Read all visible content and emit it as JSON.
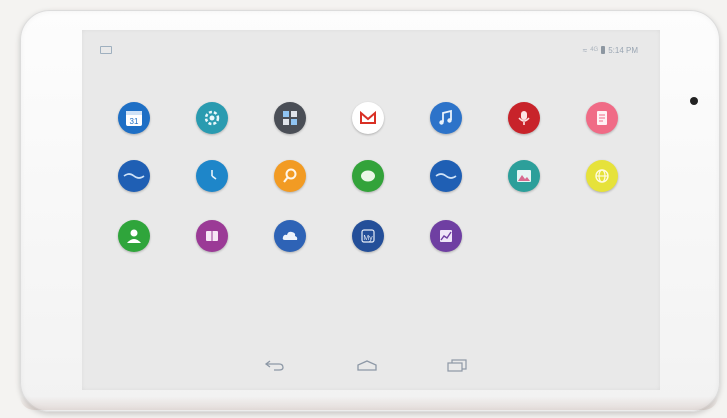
{
  "status_bar": {
    "network_label": "4G",
    "time": "5:14 PM"
  },
  "apps": [
    {
      "icon": "calendar-icon",
      "label_on_icon": "31",
      "color": "#1e6fc5"
    },
    {
      "icon": "settings-gear-icon",
      "color": "#2a9bb0"
    },
    {
      "icon": "apps-grid-icon",
      "color": "#4a4e56"
    },
    {
      "icon": "gmail-icon",
      "color": "#ffffff"
    },
    {
      "icon": "music-player-icon",
      "color": "#2d73c9"
    },
    {
      "icon": "voice-recorder-icon",
      "color": "#c8232a"
    },
    {
      "icon": "notes-icon",
      "color": "#f06b86"
    },
    {
      "icon": "browser-icon",
      "color": "#1f5fb4"
    },
    {
      "icon": "clock-icon",
      "color": "#1e86c9"
    },
    {
      "icon": "search-icon",
      "color": "#f29b23"
    },
    {
      "icon": "messaging-icon",
      "color": "#33a33a"
    },
    {
      "icon": "email-icon",
      "color": "#1f5fb4"
    },
    {
      "icon": "gallery-icon",
      "color": "#2c9f9a"
    },
    {
      "icon": "browser-globe-icon",
      "color": "#e6e23a"
    },
    {
      "icon": "contacts-icon",
      "color": "#2fa53b"
    },
    {
      "icon": "ebook-icon",
      "color": "#9b3a96"
    },
    {
      "icon": "cloud-icon",
      "color": "#2e63b6"
    },
    {
      "icon": "my-app-icon",
      "label_on_icon": "My",
      "color": "#244f99"
    },
    {
      "icon": "stocks-icon",
      "color": "#6f3fa2"
    }
  ],
  "nav": {
    "back": "back-icon",
    "home": "home-icon",
    "recents": "recent-apps-icon"
  }
}
